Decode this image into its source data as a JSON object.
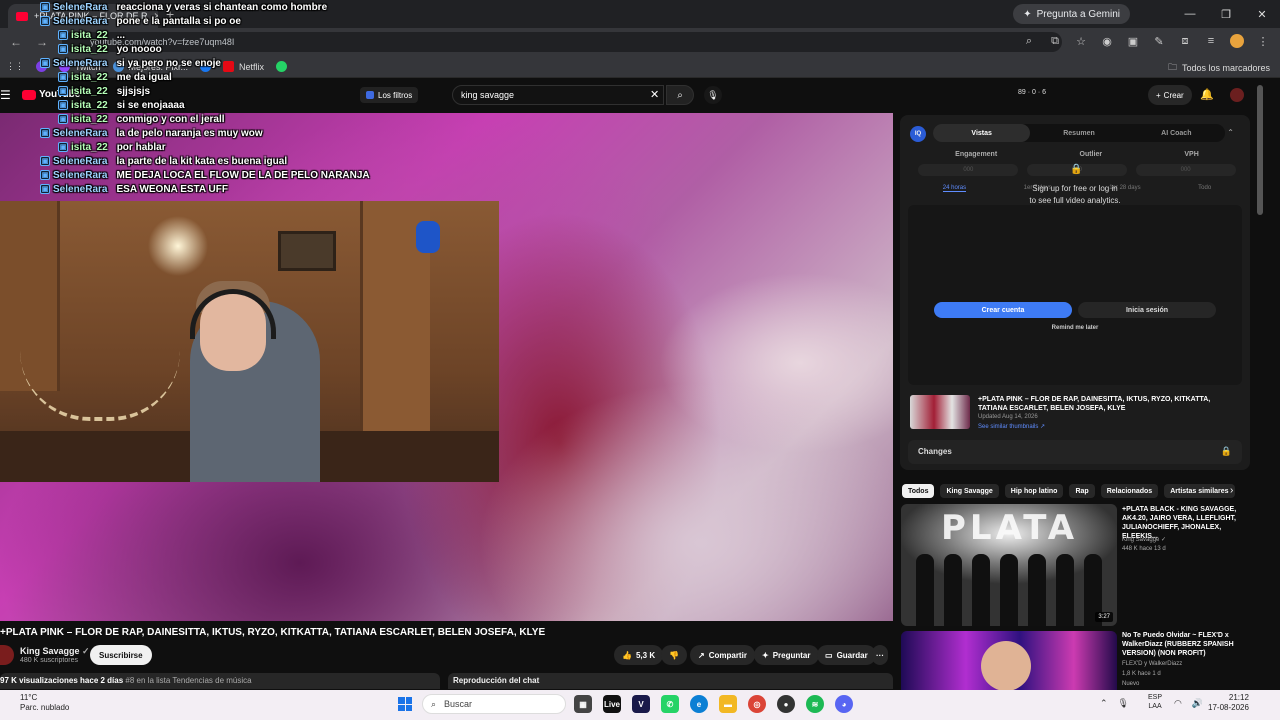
{
  "browser": {
    "tab_title": "+PLATA PINK – FLOR DE R",
    "tab_close": "✕",
    "new_tab": "+",
    "gemini_label": "Pregunta a Gemini",
    "url": "youtube.com/watch?v=fzee7uqm48I",
    "bookmarks": [
      "Twitch",
      "Mejores: Pixr...",
      "Netflix"
    ],
    "bookmarks_all": "Todos los marcadores",
    "window_controls": [
      "—",
      "❐",
      "✕"
    ]
  },
  "youtube": {
    "logo_text": "YouTube",
    "filters_label": "Los filtros",
    "search_query": "king savagge",
    "stats_text": "89 · 0 · 6",
    "create_label": "Crear"
  },
  "chat": [
    {
      "user": "SeleneRara",
      "kind": "s",
      "message": "reacciona y veras si chantean como hombre"
    },
    {
      "user": "SeleneRara",
      "kind": "s",
      "message": "pone e la pantalla si po oe"
    },
    {
      "user": "isita_22",
      "kind": "i",
      "message": "..."
    },
    {
      "user": "isita_22",
      "kind": "i",
      "message": "yo noooo"
    },
    {
      "user": "SeleneRara",
      "kind": "s",
      "message": "si ya pero no se enoje"
    },
    {
      "user": "isita_22",
      "kind": "i",
      "message": "me da igual"
    },
    {
      "user": "isita_22",
      "kind": "i",
      "message": "sjjsjsjs"
    },
    {
      "user": "isita_22",
      "kind": "i",
      "message": "si se enojaaaa"
    },
    {
      "user": "isita_22",
      "kind": "i",
      "message": "conmigo y con el jerall"
    },
    {
      "user": "SeleneRara",
      "kind": "s",
      "message": "la de pelo naranja es muy wow"
    },
    {
      "user": "isita_22",
      "kind": "i",
      "message": "por hablar"
    },
    {
      "user": "SeleneRara",
      "kind": "s",
      "message": "la parte de la kit kata es buena igual"
    },
    {
      "user": "SeleneRara",
      "kind": "s",
      "message": "ME DEJA LOCA EL FLOW DE LA DE PELO NARANJA"
    },
    {
      "user": "SeleneRara",
      "kind": "s",
      "message": "ESA WEONA ESTA UFF"
    }
  ],
  "video": {
    "title": "+PLATA PINK – FLOR DE RAP, DAINESITTA, IKTUS, RYZO, KITKATTA, TATIANA ESCARLET, BELEN JOSEFA, KLYE",
    "channel": "King Savagge",
    "subscribers": "480 K suscriptores",
    "subscribe_label": "Suscribirse",
    "likes": "5,3 K",
    "share_label": "Compartir",
    "ask_label": "Preguntar",
    "save_label": "Guardar",
    "more_label": "···",
    "views_text": "97 K visualizaciones  hace 2 días",
    "trending_text": "#8 en la lista Tendencias de música",
    "chat_replay_label": "Reproducción del chat"
  },
  "analytics": {
    "badge": "IQ",
    "tabs": [
      "Vistas",
      "Resumen",
      "AI Coach"
    ],
    "metrics": [
      "Engagement",
      "Outlier",
      "VPH"
    ],
    "metric_values": [
      "000",
      "000",
      "000"
    ],
    "periods": [
      "24 horas",
      "1er 7 days",
      "1er 28 days",
      "Todo"
    ],
    "lock_line1": "Sign up for free or log in",
    "lock_line2": "to see full video analytics.",
    "create_account": "Crear cuenta",
    "login": "Inicia sesión",
    "remind": "Remind me later",
    "similar_title": "+PLATA PINK – FLOR DE RAP, DAINESITTA, IKTUS, RYZO, KITKATTA, TATIANA ESCARLET, BELEN JOSEFA, KLYE",
    "similar_updated": "Updated Aug 14, 2026",
    "similar_link": "See similar thumbnails ↗",
    "changes_label": "Changes"
  },
  "chips": [
    "Todos",
    "King Savagge",
    "Hip hop latino",
    "Rap",
    "Relacionados",
    "Artistas similares"
  ],
  "recommendations": [
    {
      "thumb_text": "PLATA",
      "duration": "3:27",
      "title": "+PLATA BLACK - KING SAVAGGE, AK4.20, JAIRO VERA, LLEFLIGHT, JULIANOCHIEFF, JHONALEX, ELEEKIS...",
      "channel": "King Savagge",
      "meta": "448 K  hace 13 d"
    },
    {
      "title": "No Te Puedo Olvidar ~ FLEX'D x WalkerDiazz (RUBBERZ SPANISH VERSION) (NON PROFIT)",
      "channel": "FLEX'D y WalkerDiazz",
      "meta": "1,8 K  hace 1 d",
      "badge": "Nuevo"
    }
  ],
  "taskbar": {
    "temp": "11°C",
    "weather": "Parc. nublado",
    "search_label": "Buscar",
    "lang1": "ESP",
    "lang2": "LAA",
    "time": "21:12",
    "date": "17-08-2026"
  }
}
